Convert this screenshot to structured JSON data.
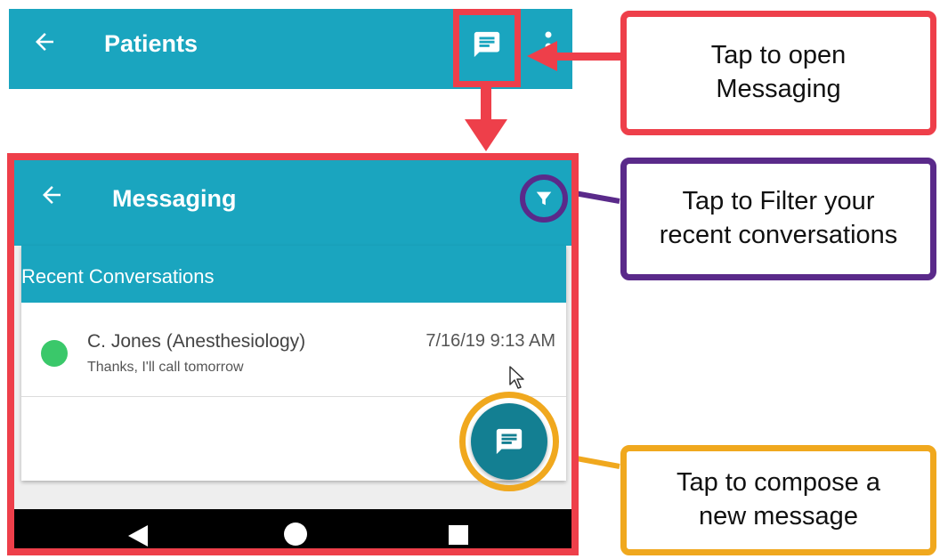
{
  "patients_bar": {
    "title": "Patients",
    "back_icon": "arrow-left-icon",
    "message_icon": "chat-bubble-icon",
    "more_icon": "more-vertical-icon"
  },
  "messaging": {
    "title": "Messaging",
    "back_icon": "arrow-left-icon",
    "filter_icon": "filter-icon",
    "section_title": "Recent Conversations",
    "conversations": [
      {
        "name": "C. Jones (Anesthesiology)",
        "timestamp": "7/16/19 9:13 AM",
        "preview": "Thanks, I'll call tomorrow",
        "status": "online"
      }
    ],
    "compose_icon": "chat-bubble-icon"
  },
  "nav": {
    "back_icon": "nav-back-icon",
    "home_icon": "nav-home-icon",
    "recent_icon": "nav-recent-icon"
  },
  "callouts": {
    "messaging": "Tap to open\nMessaging",
    "filter": "Tap to Filter your\nrecent conversations",
    "compose": "Tap to compose a\nnew message"
  },
  "colors": {
    "app_bar": "#1aa5bf",
    "fab": "#137f92",
    "highlight_red": "#ee3f4a",
    "highlight_purple": "#5a2a8a",
    "highlight_orange": "#f0a81e",
    "status_online": "#3ac86a"
  }
}
